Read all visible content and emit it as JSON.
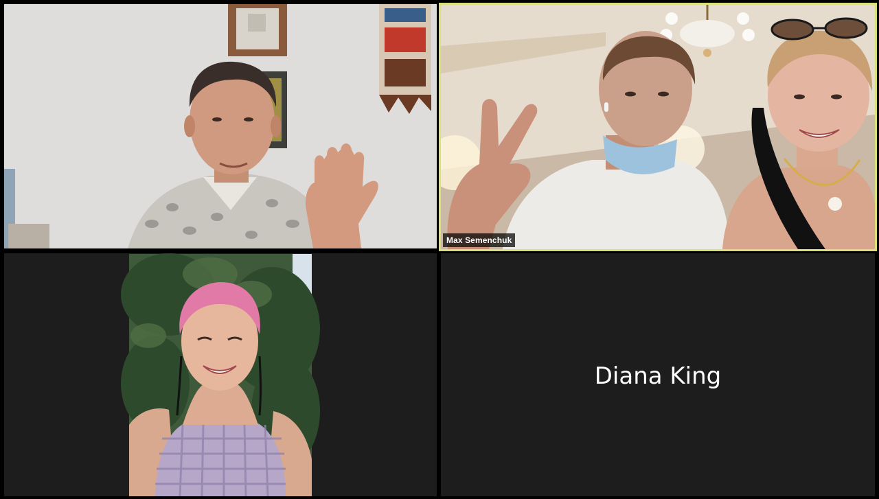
{
  "participants": [
    {
      "id": "p1",
      "video": true,
      "name_label": ""
    },
    {
      "id": "p2",
      "video": true,
      "name_label": "Max Semenchuk",
      "active_speaker": true
    },
    {
      "id": "p3",
      "video": true,
      "name_label": ""
    },
    {
      "id": "p4",
      "video": false,
      "display_name": "Diana King"
    }
  ],
  "colors": {
    "background": "#000000",
    "tile_background": "#1d1d1d",
    "active_speaker_border": "#d9e27a",
    "name_label_text": "#ffffff"
  }
}
